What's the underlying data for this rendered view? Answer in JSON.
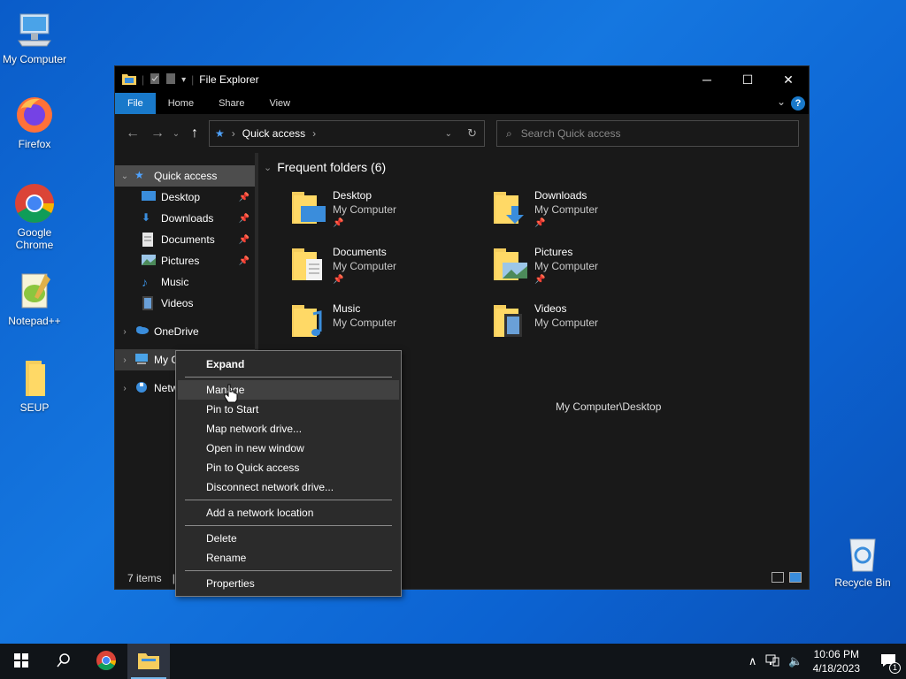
{
  "desktop": {
    "icons": [
      {
        "label": "My Computer"
      },
      {
        "label": "Firefox"
      },
      {
        "label": "Google Chrome"
      },
      {
        "label": "Notepad++"
      },
      {
        "label": "SEUP"
      },
      {
        "label": "Recycle Bin"
      }
    ]
  },
  "window": {
    "title": "File Explorer",
    "ribbon_tabs": [
      "File",
      "Home",
      "Share",
      "View"
    ],
    "help_label": "?",
    "address": {
      "crumb": "Quick access"
    },
    "search_placeholder": "Search Quick access"
  },
  "navpane": {
    "items": [
      {
        "label": "Quick access"
      },
      {
        "label": "Desktop"
      },
      {
        "label": "Downloads"
      },
      {
        "label": "Documents"
      },
      {
        "label": "Pictures"
      },
      {
        "label": "Music"
      },
      {
        "label": "Videos"
      },
      {
        "label": "OneDrive"
      },
      {
        "label": "My C"
      },
      {
        "label": "Netw"
      }
    ]
  },
  "main": {
    "group_title": "Frequent folders (6)",
    "folders": [
      {
        "name": "Desktop",
        "location": "My Computer"
      },
      {
        "name": "Downloads",
        "location": "My Computer"
      },
      {
        "name": "Documents",
        "location": "My Computer"
      },
      {
        "name": "Pictures",
        "location": "My Computer"
      },
      {
        "name": "Music",
        "location": "My Computer"
      },
      {
        "name": "Videos",
        "location": "My Computer"
      }
    ],
    "recent_path": "My Computer\\Desktop"
  },
  "status": {
    "items": "7 items",
    "divider": "|"
  },
  "context_menu": {
    "items": [
      "Expand",
      "Manage",
      "Pin to Start",
      "Map network drive...",
      "Open in new window",
      "Pin to Quick access",
      "Disconnect network drive...",
      "Add a network location",
      "Delete",
      "Rename",
      "Properties"
    ]
  },
  "taskbar": {
    "time": "10:06 PM",
    "date": "4/18/2023",
    "notification_count": "1"
  },
  "colors": {
    "accent": "#1979ca",
    "window_bg": "#191919",
    "desktop_bg": "#1068d4"
  }
}
